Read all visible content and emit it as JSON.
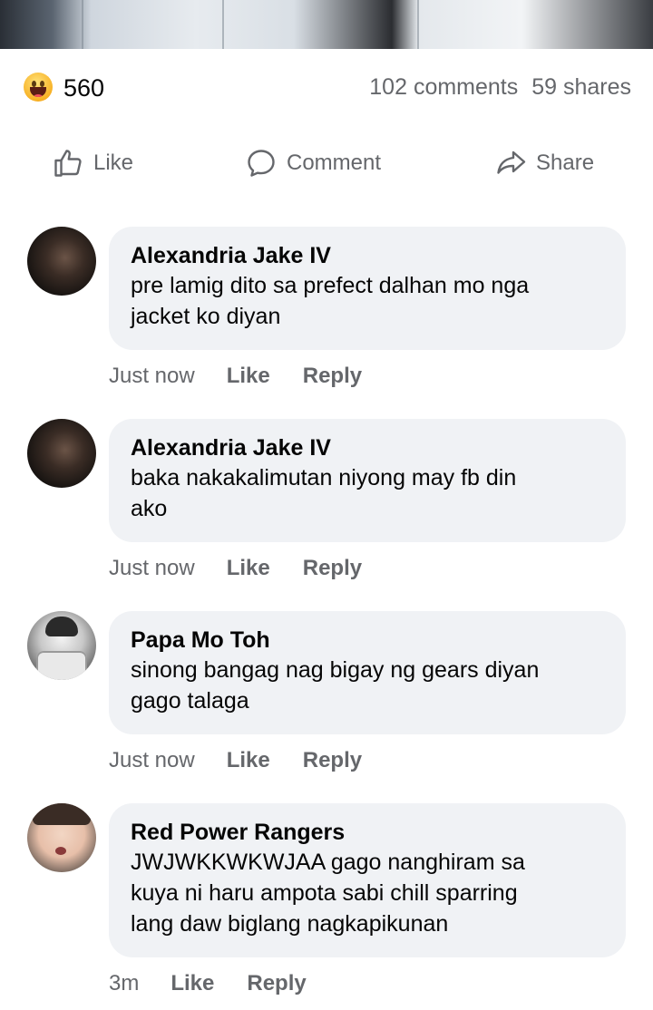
{
  "post": {
    "reaction_icon": "haha-emoji-icon",
    "reaction_count": "560",
    "comments_count": "102 comments",
    "shares_count": "59 shares"
  },
  "actions": {
    "like": "Like",
    "comment": "Comment",
    "share": "Share"
  },
  "comments": [
    {
      "name": "Alexandria Jake IV",
      "text": "pre lamig dito sa prefect dalhan mo nga\njacket ko diyan",
      "time": "Just now",
      "like": "Like",
      "reply": "Reply"
    },
    {
      "name": "Alexandria Jake IV",
      "text": "baka nakakalimutan niyong may fb din\nako",
      "time": "Just now",
      "like": "Like",
      "reply": "Reply"
    },
    {
      "name": "Papa Mo Toh",
      "text": "sinong bangag nag bigay ng gears diyan\ngago talaga",
      "time": "Just now",
      "like": "Like",
      "reply": "Reply"
    },
    {
      "name": "Red Power Rangers",
      "text": "JWJWKKWKWJAA gago nanghiram sa\nkuya ni haru ampota sabi chill sparring\nlang daw biglang nagkapikunan",
      "time": "3m",
      "like": "Like",
      "reply": "Reply"
    }
  ],
  "colors": {
    "bubble": "#f0f2f5",
    "secondary_text": "#65676b",
    "primary_text": "#050505"
  }
}
